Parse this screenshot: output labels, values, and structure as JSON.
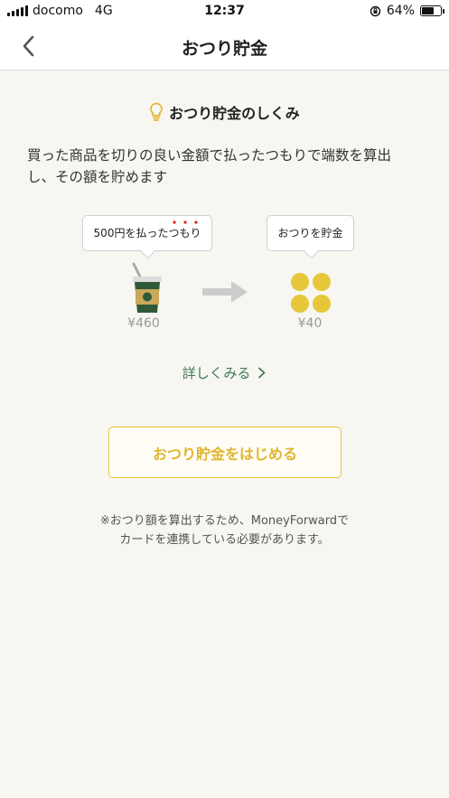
{
  "status_bar": {
    "carrier": "docomo",
    "network": "4G",
    "time": "12:37",
    "battery_text": "64%",
    "battery_level": 0.64
  },
  "nav": {
    "title": "おつり貯金",
    "back_icon": "chevron-left-icon"
  },
  "heading": {
    "icon": "lightbulb-icon",
    "text": "おつり貯金のしくみ"
  },
  "description": {
    "line1": "買った商品を切りの良い金額で払ったつもりで端数を算出",
    "line2": "し、その額を貯めます"
  },
  "illustration": {
    "paid_bubble": "500円を払ったつもり",
    "save_bubble": "おつりを貯金",
    "item_icon": "coffee-cup-icon",
    "arrow_icon": "arrow-right-icon",
    "coins_icon": "coins-icon",
    "item_price": "¥460",
    "change_amount": "¥40"
  },
  "details_link": {
    "label": "詳しくみる",
    "icon": "chevron-right-icon"
  },
  "start_button": {
    "label": "おつり貯金をはじめる"
  },
  "note": {
    "line1": "※おつり額を算出するため、MoneyForwardで",
    "line2": "カードを連携している必要があります。"
  },
  "colors": {
    "accent_yellow": "#e8c23a",
    "link_green": "#3b7a58",
    "emphasis_red": "#e02020",
    "background": "#f7f6f1"
  }
}
